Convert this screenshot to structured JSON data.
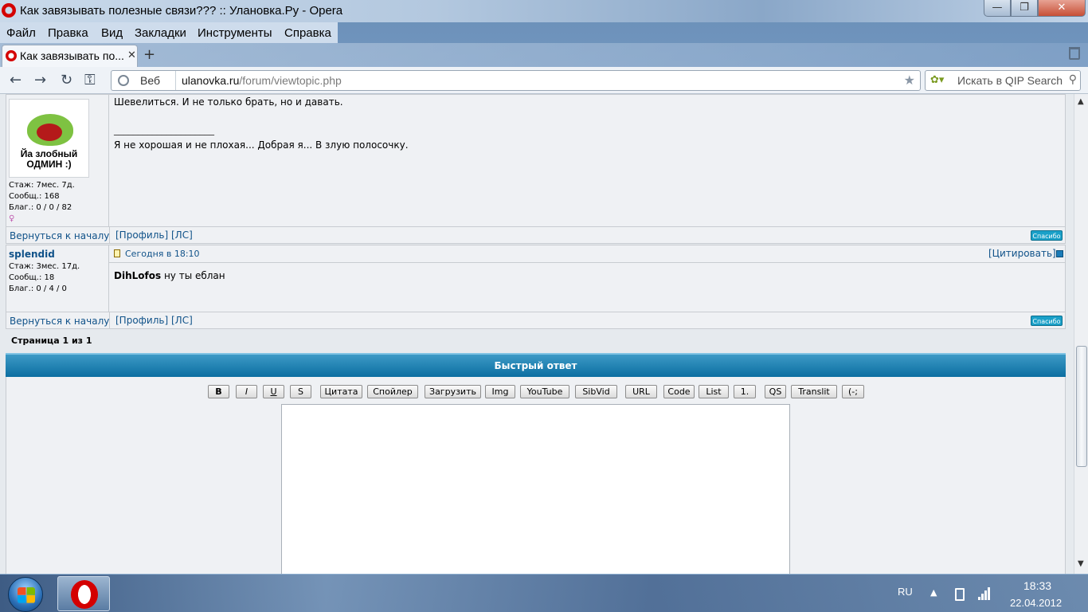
{
  "window": {
    "title": "Как завязывать полезные связи??? :: Улановка.Ру - Opera",
    "min": "—",
    "max": "❐",
    "close": "✕"
  },
  "menu": [
    "Файл",
    "Правка",
    "Вид",
    "Закладки",
    "Инструменты",
    "Справка"
  ],
  "tab": {
    "label": "Как завязывать по...",
    "close": "✕"
  },
  "new_tab": "+",
  "nav": {
    "back": "←",
    "forward": "→",
    "reload": "↻",
    "key": "⚿",
    "address_prefix": "Веб",
    "url_host": "ulanovka.ru",
    "url_path": "/forum/viewtopic.php",
    "star": "★",
    "search_placeholder": "Искать в QIP Search",
    "search_icon": "⚲",
    "qip_icon": "✿▾"
  },
  "post1": {
    "avatar_caption": "Йа злобный ОДМИН :)",
    "stats": [
      "Стаж: 7мес. 7д.",
      "Сообщ.: 168",
      "Благ.: 0 / 0 / 82"
    ],
    "gender": "♀",
    "text_line1": "Шевелиться. И не только брать, но и давать.",
    "sig_line": "_____________________",
    "signature": "Я не хорошая и не плохая... Добрая я... В злую полосочку.",
    "back_to_top": "Вернуться к началу",
    "profile": "[Профиль]",
    "pm": "[ЛС]",
    "thanks": "Спасибо"
  },
  "post2": {
    "author": "splendid",
    "stats": [
      "Стаж: 3мес. 17д.",
      "Сообщ.: 18",
      "Благ.: 0 / 4 / 0"
    ],
    "timestamp": "Сегодня в 18:10",
    "quote": "[Цитировать]",
    "body_name": "DihLofos",
    "body_text": " ну ты еблан",
    "back_to_top": "Вернуться к началу",
    "profile": "[Профиль]",
    "pm": "[ЛС]",
    "thanks": "Спасибо"
  },
  "pagination": "Страница 1 из 1",
  "quick_reply": {
    "title": "Быстрый ответ",
    "buttons": [
      "B",
      "I",
      "U",
      "S",
      "Цитата",
      "Спойлер",
      "Загрузить",
      "Img",
      "YouTube",
      "SibVid",
      "URL",
      "Code",
      "List",
      "1.",
      "QS",
      "Translit",
      "(-;"
    ]
  },
  "taskbar": {
    "lang": "RU",
    "tray_arrow": "▲",
    "time": "18:33",
    "date": "22.04.2012"
  }
}
